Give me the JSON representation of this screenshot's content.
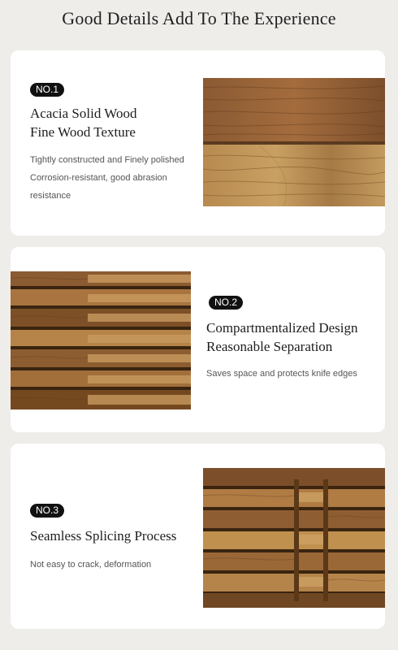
{
  "page_title": "Good Details Add To The Experience",
  "sections": [
    {
      "badge": "NO.1",
      "heading_line1": "Acacia Solid Wood",
      "heading_line2": "Fine Wood Texture",
      "desc_lines": [
        "Tightly constructed and Finely polished",
        "Corrosion-resistant, good abrasion",
        "resistance"
      ]
    },
    {
      "badge": "NO.2",
      "heading_line1": "Compartmentalized Design",
      "heading_line2": "Reasonable Separation",
      "desc_lines": [
        "Saves space and protects knife edges"
      ]
    },
    {
      "badge": "NO.3",
      "heading_line1": "Seamless Splicing Process",
      "desc_lines": [
        "Not easy to crack, deformation"
      ]
    }
  ],
  "colors": {
    "background": "#efedea",
    "card": "#ffffff",
    "badge": "#111111",
    "wood_dark": "#6b4a2a",
    "wood_mid": "#a07443",
    "wood_light": "#c9a06a"
  }
}
